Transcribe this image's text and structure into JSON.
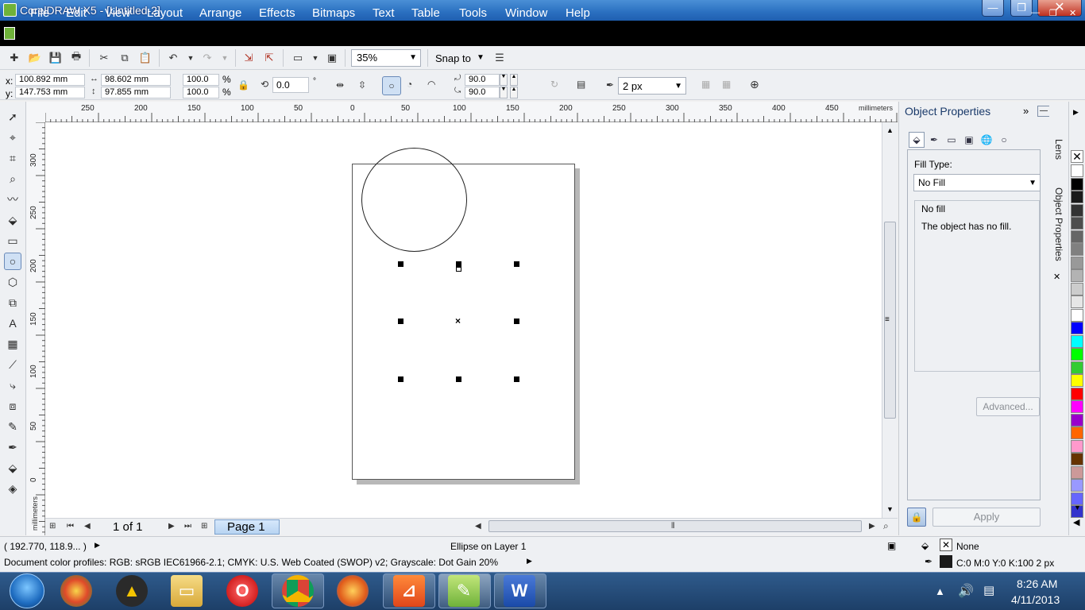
{
  "window": {
    "title": "CorelDRAW X5 - [Untitled-2]"
  },
  "menu": [
    {
      "label": "File"
    },
    {
      "label": "Edit"
    },
    {
      "label": "View"
    },
    {
      "label": "Layout"
    },
    {
      "label": "Arrange"
    },
    {
      "label": "Effects"
    },
    {
      "label": "Bitmaps"
    },
    {
      "label": "Text"
    },
    {
      "label": "Table"
    },
    {
      "label": "Tools"
    },
    {
      "label": "Window"
    },
    {
      "label": "Help"
    }
  ],
  "toolbar": {
    "zoom": "35%",
    "snap_to": "Snap to"
  },
  "propbar": {
    "x_label": "x:",
    "y_label": "y:",
    "x": "100.892 mm",
    "y": "147.753 mm",
    "width": "98.602 mm",
    "height": "97.855 mm",
    "scale_x": "100.0",
    "scale_y": "100.0",
    "pct": "%",
    "rotation": "0.0",
    "degree": "°",
    "start_angle": "90.0",
    "end_angle": "90.0",
    "outline_width": "2 px"
  },
  "rulers": {
    "top_ticks": [
      "250",
      "200",
      "150",
      "100",
      "50",
      "0",
      "50",
      "100",
      "150",
      "200",
      "250",
      "300",
      "350",
      "400",
      "450"
    ],
    "left_ticks": [
      "300",
      "250",
      "200",
      "150",
      "100",
      "50",
      "0"
    ],
    "unit": "millimeters"
  },
  "pages": {
    "count": "1 of 1",
    "tab": "Page 1"
  },
  "docker": {
    "title": "Object Properties",
    "fill_type_label": "Fill Type:",
    "fill_type": "No Fill",
    "fill_name": "No fill",
    "fill_description": "The object has no fill.",
    "advanced": "Advanced...",
    "apply": "Apply",
    "side_tabs": [
      "Lens",
      "Object Properties"
    ]
  },
  "palette": [
    "#ffffff",
    "#000000",
    "#1a1a1a",
    "#333333",
    "#4d4d4d",
    "#666666",
    "#808080",
    "#999999",
    "#b3b3b3",
    "#cccccc",
    "#e6e6e6",
    "#ffffff",
    "#0000ff",
    "#00ffff",
    "#00ff00",
    "#33cc33",
    "#ffff00",
    "#ff0000",
    "#ff00ff",
    "#9900cc",
    "#ff6600",
    "#ff99cc",
    "#663300",
    "#cc9999",
    "#9999ff",
    "#6666ff",
    "#3333cc"
  ],
  "status": {
    "coords": "( 192.770, 118.9... )",
    "object_info": "Ellipse on Layer 1",
    "color_profiles": "Document color profiles: RGB: sRGB IEC61966-2.1; CMYK: U.S. Web Coated (SWOP) v2; Grayscale: Dot Gain 20%",
    "fill": "None",
    "outline": "C:0 M:0 Y:0 K:100  2 px"
  },
  "taskbar": {
    "time": "8:26 AM",
    "date": "4/11/2013"
  }
}
